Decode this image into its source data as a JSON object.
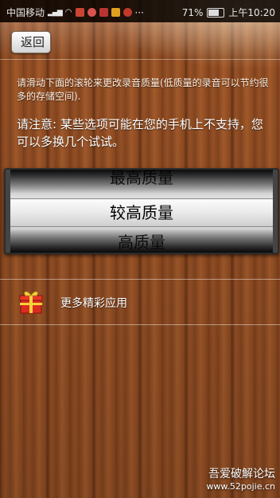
{
  "status_bar": {
    "carrier": "中国移动",
    "battery_percent": "71%",
    "time": "上午10:20",
    "battery_level": 0.71
  },
  "header": {
    "back_label": "返回"
  },
  "content": {
    "description": "请滑动下面的滚轮来更改录音质量(低质量的录音可以节约很多的存储空间).",
    "notice": "请注意: 某些选项可能在您的手机上不支持，您可以多换几个试试。"
  },
  "quality_picker": {
    "options_visible": [
      "最高质量",
      "较高质量",
      "高质量"
    ],
    "selected": "较高质量"
  },
  "more_apps": {
    "label": "更多精彩应用",
    "icon": "gift-icon"
  },
  "watermark": {
    "site_name": "吾爱破解论坛",
    "url": "www.52pojie.cn"
  }
}
